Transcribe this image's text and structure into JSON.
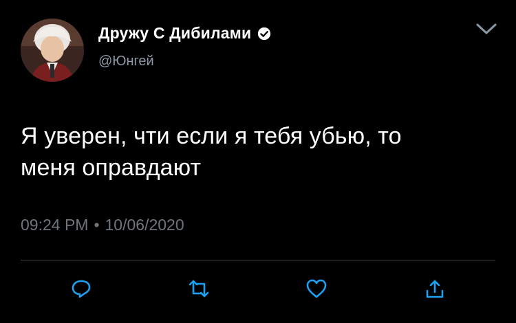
{
  "author": {
    "display_name": "Дружу С Дибилами",
    "handle": "@Юнгей",
    "verified": true
  },
  "tweet": {
    "text_line1": "Я уверен, чти если я тебя убью, то",
    "text_line2": "меня оправдают",
    "time": "09:24 PM",
    "separator": "•",
    "date": "10/06/2020"
  },
  "icons": {
    "menu": "chevron-down-icon",
    "reply": "reply-icon",
    "retweet": "retweet-icon",
    "like": "heart-icon",
    "share": "share-icon"
  },
  "colors": {
    "background": "#000000",
    "muted_text": "#6e767d",
    "icon": "#1da1f2"
  }
}
